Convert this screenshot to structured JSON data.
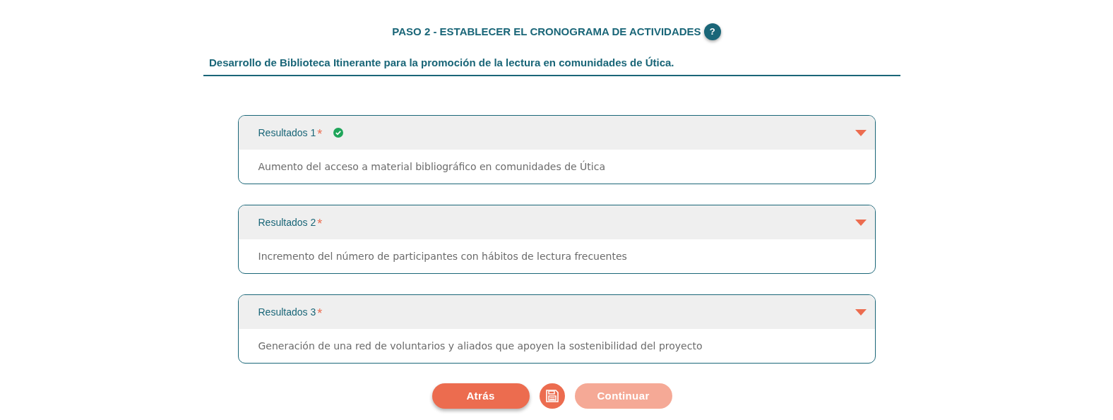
{
  "step_title": "PASO 2 - ESTABLECER EL CRONOGRAMA DE ACTIVIDADES",
  "help_button": "?",
  "project_title": "Desarrollo de Biblioteca Itinerante para la promoción de la lectura en comunidades de Útica.",
  "results": [
    {
      "label": "Resultados 1",
      "required_mark": "*",
      "complete": true,
      "expanded": false,
      "description": "Aumento del acceso a material bibliográfico en comunidades de Útica"
    },
    {
      "label": "Resultados 2",
      "required_mark": "*",
      "complete": false,
      "expanded": false,
      "description": "Incremento del número de participantes con hábitos de lectura frecuentes"
    },
    {
      "label": "Resultados 3",
      "required_mark": "*",
      "complete": false,
      "expanded": false,
      "description": "Generación de una red de voluntarios y aliados que apoyen la sostenibilidad del proyecto"
    }
  ],
  "buttons": {
    "back": {
      "label": "Atrás",
      "disabled": false
    },
    "continue": {
      "label": "Continuar",
      "disabled": true
    }
  }
}
